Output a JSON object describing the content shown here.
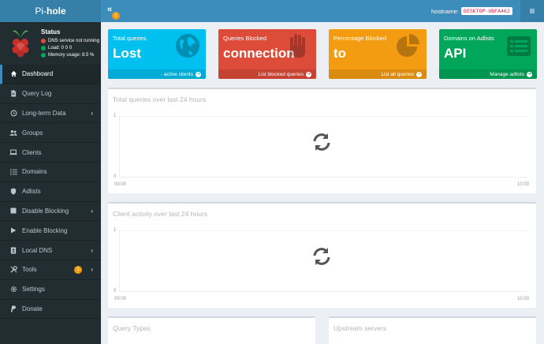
{
  "app": {
    "logo_prefix": "Pi-",
    "logo_suffix": "hole"
  },
  "topbar": {
    "toggle_badge": "1",
    "hostname_label": "hostname:",
    "hostname_value": "DESKTOP-UBFA462"
  },
  "status": {
    "title": "Status",
    "dns": "DNS service not running",
    "load": "Load:  0  0  0",
    "memory": "Memory usage:  8.5 %"
  },
  "menu": [
    {
      "label": "Dashboard",
      "icon": "home-icon"
    },
    {
      "label": "Query Log",
      "icon": "file-icon"
    },
    {
      "label": "Long-term Data",
      "icon": "history-icon"
    },
    {
      "label": "Groups",
      "icon": "users-icon"
    },
    {
      "label": "Clients",
      "icon": "laptop-icon"
    },
    {
      "label": "Domains",
      "icon": "list-icon"
    },
    {
      "label": "Adlists",
      "icon": "shield-icon"
    },
    {
      "label": "Disable Blocking",
      "icon": "stop-icon"
    },
    {
      "label": "Enable Blocking",
      "icon": "play-icon"
    },
    {
      "label": "Local DNS",
      "icon": "address-book-icon"
    },
    {
      "label": "Tools",
      "icon": "tools-icon",
      "badge": "1"
    },
    {
      "label": "Settings",
      "icon": "gear-icon"
    },
    {
      "label": "Donate",
      "icon": "paypal-icon"
    }
  ],
  "boxes": [
    {
      "title": "Total queries",
      "value": "Lost",
      "footer": "- active clients",
      "color": "#00c0ef",
      "icon": "globe-icon"
    },
    {
      "title": "Queries Blocked",
      "value": "connection",
      "footer": "List blocked queries",
      "color": "#dd4b39",
      "icon": "hand-icon"
    },
    {
      "title": "Percentage Blocked",
      "value": "to",
      "footer": "List all queries",
      "color": "#f39c12",
      "icon": "pie-chart-icon"
    },
    {
      "title": "Domains on Adlists",
      "value": "API",
      "footer": "Manage adlists",
      "color": "#00a65a",
      "icon": "list-alt-icon"
    }
  ],
  "panels": {
    "total_queries": {
      "title": "Total queries over last 24 hours",
      "y_top": "1",
      "y_bottom": "0",
      "x_start": "09:00",
      "x_end": "10:00"
    },
    "client_activity": {
      "title": "Client activity over last 24 hours",
      "y_top": "1",
      "y_bottom": "0",
      "x_start": "09:00",
      "x_end": "10:00"
    },
    "query_types": {
      "title": "Query Types"
    },
    "upstream": {
      "title": "Upstream servers"
    }
  },
  "colors": {
    "accent": "#3c8dbc",
    "sidebar": "#222d32",
    "status_red": "#dd4b39",
    "status_green": "#00a65a"
  }
}
